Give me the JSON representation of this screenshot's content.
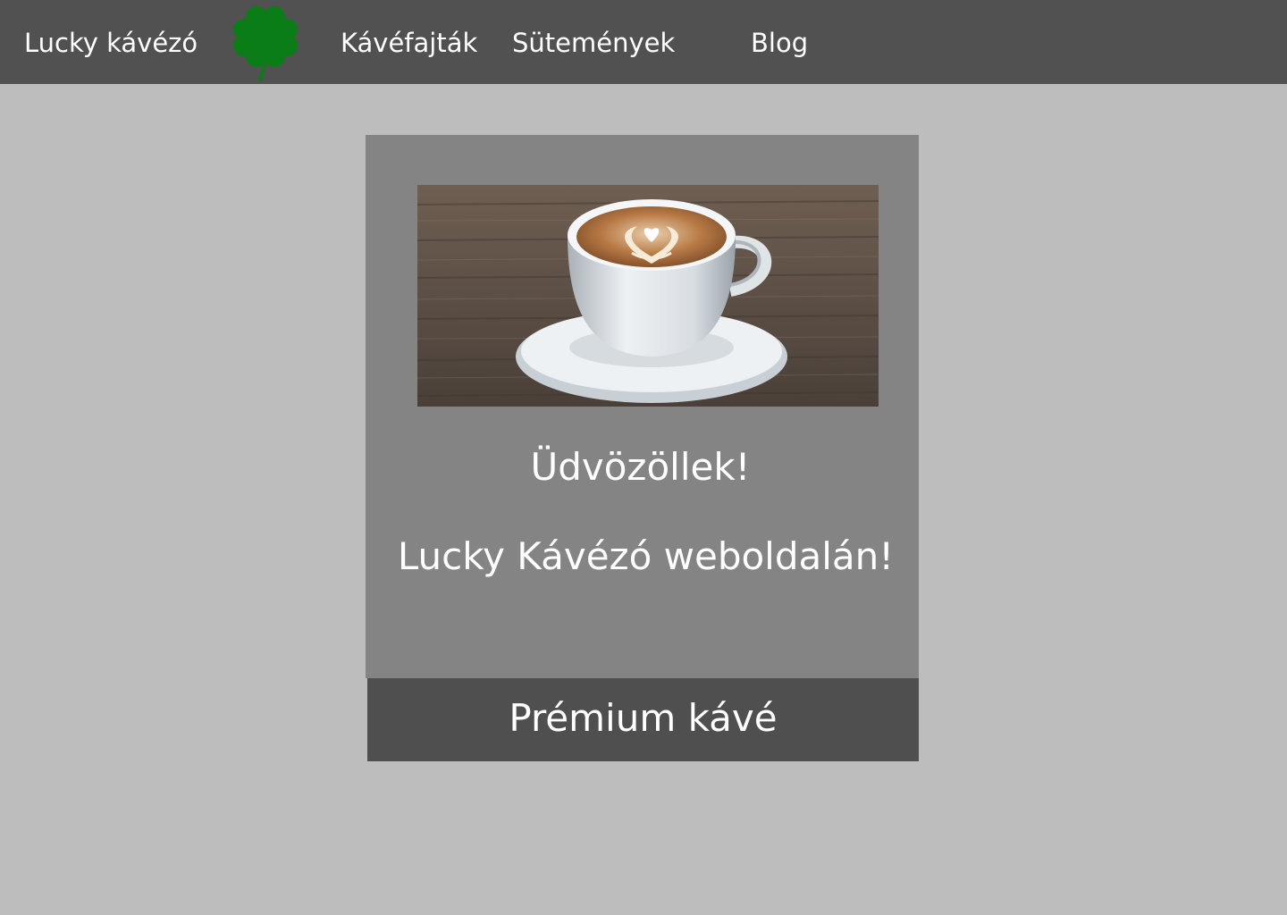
{
  "navbar": {
    "brand": "Lucky kávézó",
    "logo_icon": "four-leaf-clover-icon",
    "logo_color": "#0a7d17",
    "items": [
      {
        "label": "Kávéfajták"
      },
      {
        "label": "Sütemények"
      },
      {
        "label": "Blog"
      }
    ]
  },
  "hero": {
    "image_icon": "coffee-cup-photo",
    "title": "Üdvözöllek!",
    "subtitle": "Lucky Kávézó weboldalán!"
  },
  "cta": {
    "label": "Prémium kávé"
  },
  "colors": {
    "page_background": "#bdbdbd",
    "navbar_background": "#515151",
    "card_background": "#848484",
    "button_background": "#4f4f4f",
    "text": "#ffffff"
  }
}
